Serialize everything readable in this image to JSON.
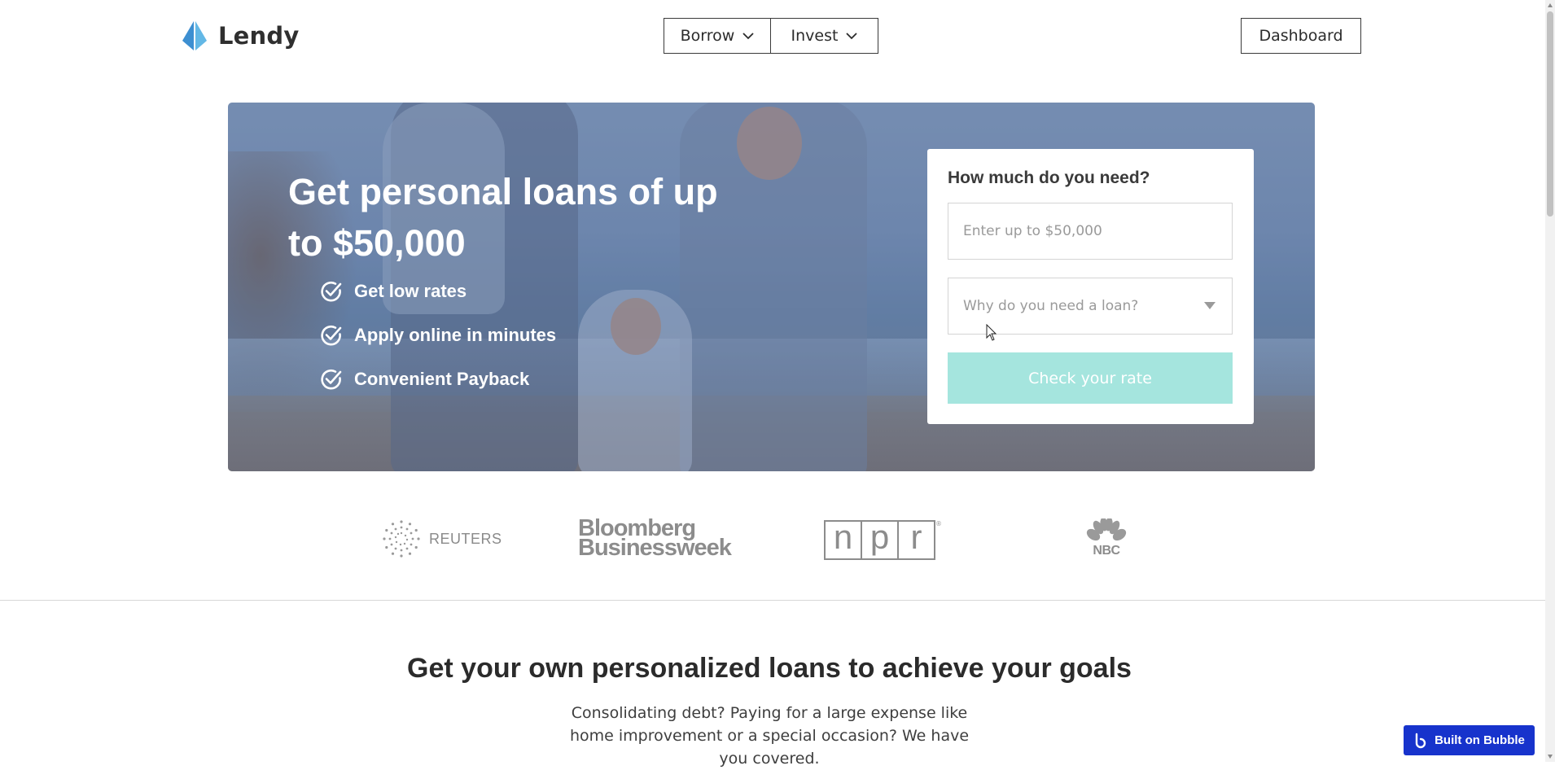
{
  "header": {
    "logo_text": "Lendy",
    "nav": [
      {
        "label": "Borrow"
      },
      {
        "label": "Invest"
      }
    ],
    "dashboard_label": "Dashboard"
  },
  "hero": {
    "title": "Get personal loans of up to $50,000",
    "benefits": [
      {
        "label": "Get low rates"
      },
      {
        "label": "Apply online in minutes"
      },
      {
        "label": "Convenient Payback"
      }
    ]
  },
  "loan_form": {
    "title": "How much do you need?",
    "amount_placeholder": "Enter up to $50,000",
    "amount_value": "",
    "purpose_placeholder": "Why do you need a loan?",
    "cta_label": "Check your rate"
  },
  "press": {
    "reuters": "REUTERS",
    "bloomberg_line1": "Bloomberg",
    "bloomberg_line2": "Businessweek",
    "npr_letters": [
      "n",
      "p",
      "r"
    ],
    "npr_mark": "®",
    "nbc": "NBC"
  },
  "section": {
    "title": "Get your own personalized loans to achieve your goals",
    "description": "Consolidating debt? Paying for a large expense like home improvement or a special occasion? We have you covered."
  },
  "badge": {
    "label": "Built on Bubble"
  },
  "colors": {
    "accent_logo": "#4aa3df",
    "cta": "#a5e5de",
    "badge": "#1733cc"
  }
}
